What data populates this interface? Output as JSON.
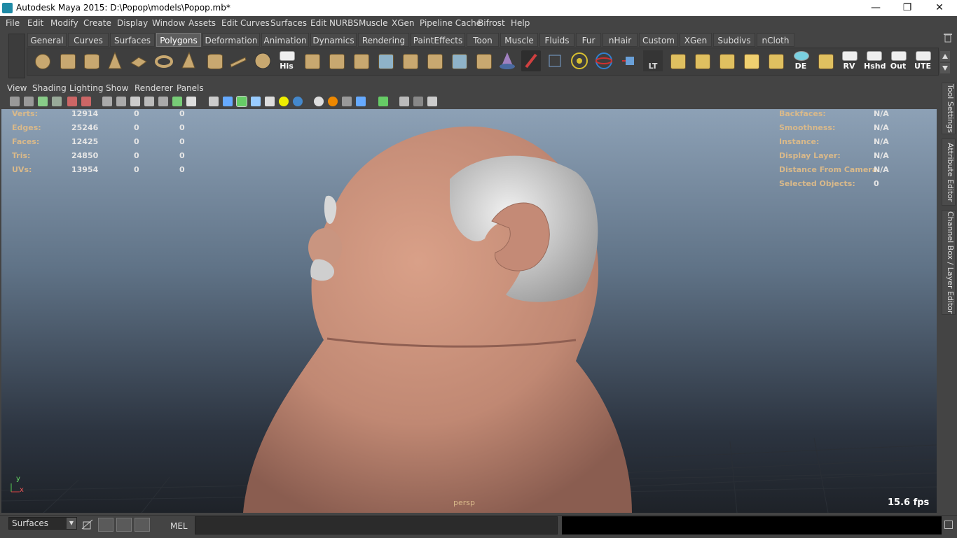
{
  "window": {
    "title": "Autodesk Maya 2015: D:\\Popop\\models\\Popop.mb*",
    "minimize": "—",
    "maximize": "❐",
    "close": "✕"
  },
  "menubar": [
    "File",
    "Edit",
    "Modify",
    "Create",
    "Display",
    "Window",
    "Assets",
    "Edit Curves",
    "Surfaces",
    "Edit NURBS",
    "Muscle",
    "XGen",
    "Pipeline Cache",
    "Bifrost",
    "Help"
  ],
  "shelf": {
    "tabs": [
      "General",
      "Curves",
      "Surfaces",
      "Polygons",
      "Deformation",
      "Animation",
      "Dynamics",
      "Rendering",
      "PaintEffects",
      "Toon",
      "Muscle",
      "Fluids",
      "Fur",
      "nHair",
      "Custom",
      "XGen",
      "Subdivs",
      "nCloth"
    ],
    "active_tab": "Polygons",
    "labeled_icons": {
      "his": "His",
      "lt": "LT",
      "de": "DE",
      "rv": "RV",
      "hshd": "Hshd",
      "out": "Out",
      "ute": "UTE"
    }
  },
  "panel_menu": [
    "View",
    "Shading",
    "Lighting",
    "Show",
    "Renderer",
    "Panels"
  ],
  "hud_left": [
    {
      "label": "Verts:",
      "v1": "12914",
      "v2": "0",
      "v3": "0"
    },
    {
      "label": "Edges:",
      "v1": "25246",
      "v2": "0",
      "v3": "0"
    },
    {
      "label": "Faces:",
      "v1": "12425",
      "v2": "0",
      "v3": "0"
    },
    {
      "label": "Tris:",
      "v1": "24850",
      "v2": "0",
      "v3": "0"
    },
    {
      "label": "UVs:",
      "v1": "13954",
      "v2": "0",
      "v3": "0"
    }
  ],
  "hud_right": [
    {
      "label": "Backfaces:",
      "value": "N/A"
    },
    {
      "label": "Smoothness:",
      "value": "N/A"
    },
    {
      "label": "Instance:",
      "value": "N/A"
    },
    {
      "label": "Display Layer:",
      "value": "N/A"
    },
    {
      "label": "Distance From Camera:",
      "value": "N/A"
    },
    {
      "label": "Selected Objects:",
      "value": "0"
    }
  ],
  "viewport": {
    "camera": "persp",
    "fps": "15.6 fps",
    "axis_y": "y",
    "axis_x": "x"
  },
  "side_tabs": {
    "tool_settings": "Tool Settings",
    "attribute_editor": "Attribute Editor",
    "channel_box": "Channel Box / Layer Editor"
  },
  "cmdline": {
    "mode_value": "Surfaces",
    "mel_label": "MEL"
  }
}
